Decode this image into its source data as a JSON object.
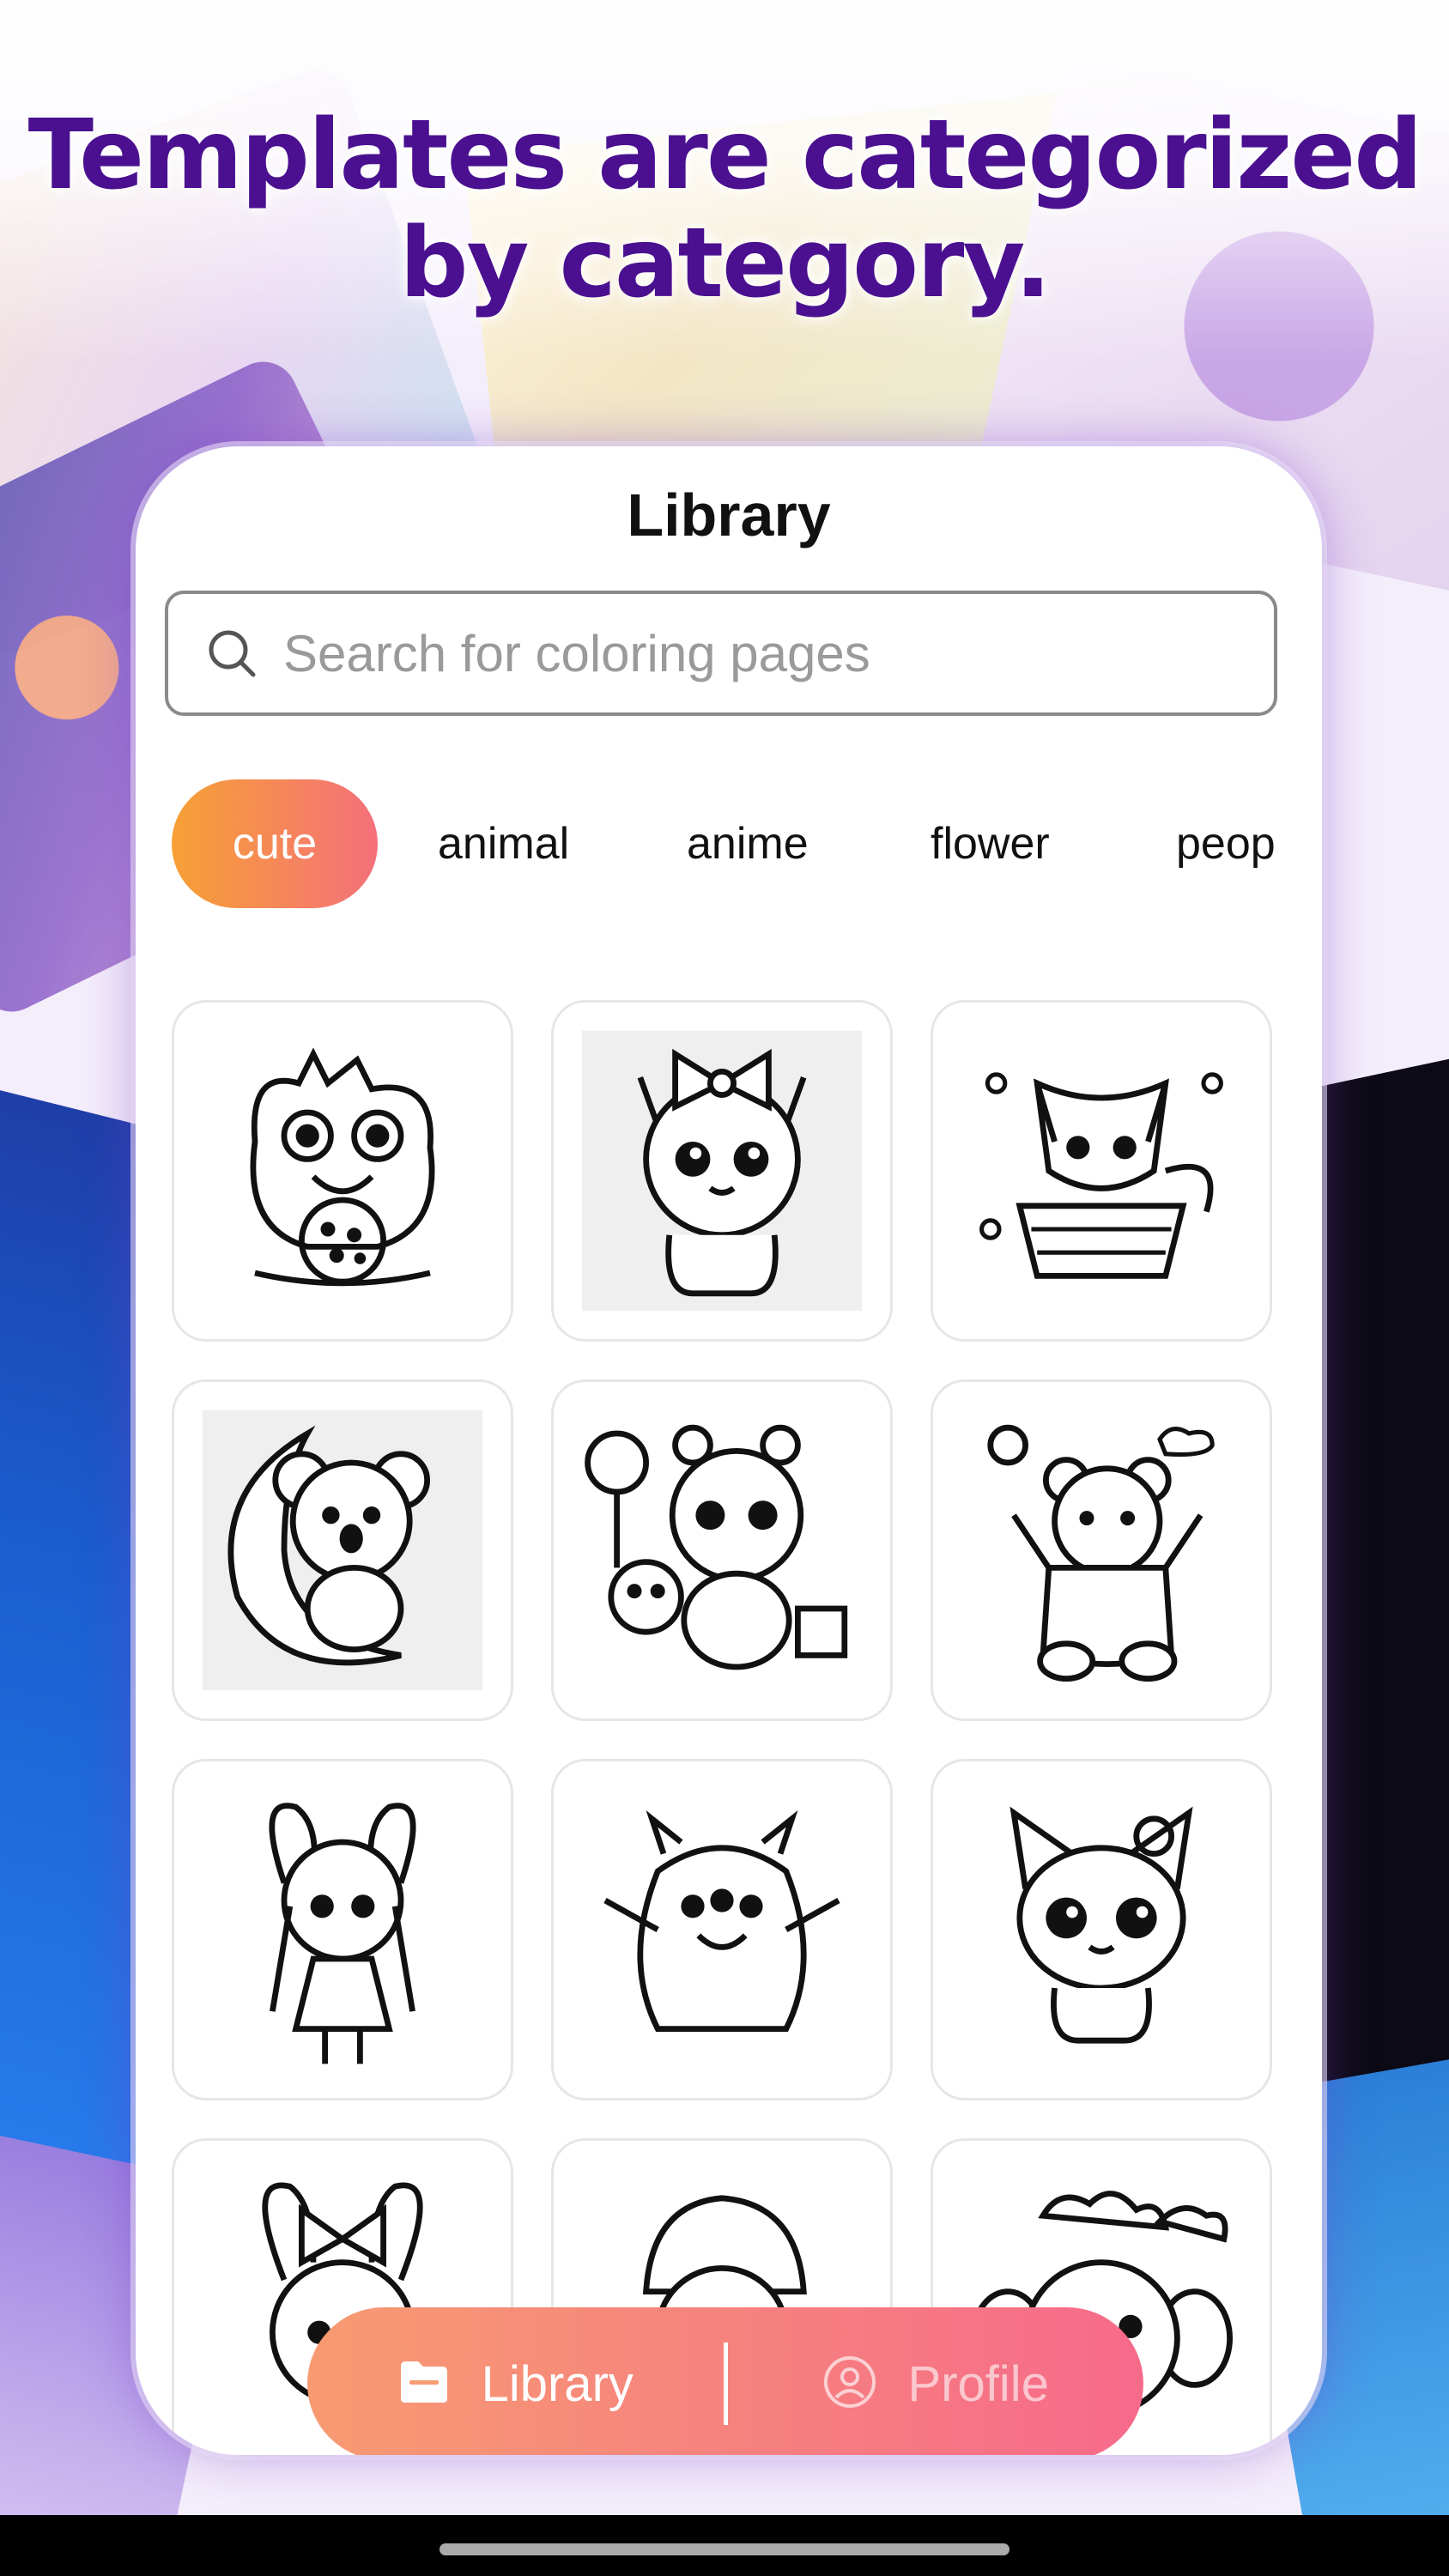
{
  "headline": {
    "line1": "Templates are categorized",
    "line2": "by category."
  },
  "screen": {
    "title": "Library",
    "search": {
      "placeholder": "Search for coloring pages",
      "icon": "search-icon"
    },
    "categories": [
      {
        "label": "cute",
        "active": true
      },
      {
        "label": "animal",
        "active": false
      },
      {
        "label": "anime",
        "active": false
      },
      {
        "label": "flower",
        "active": false
      },
      {
        "label": "peop",
        "active": false
      }
    ],
    "templates": [
      {
        "subject": "cute monster with cookie"
      },
      {
        "subject": "kitten with bow"
      },
      {
        "subject": "fox in basket"
      },
      {
        "subject": "koala on moon"
      },
      {
        "subject": "panda bears with candy"
      },
      {
        "subject": "teddy bear waving"
      },
      {
        "subject": "bunny hood girl"
      },
      {
        "subject": "fluffy monster"
      },
      {
        "subject": "kitten with flower"
      },
      {
        "subject": "bunny with bow"
      },
      {
        "subject": "anime girl with hat"
      },
      {
        "subject": "baby elephant"
      }
    ],
    "nav": {
      "library": {
        "label": "Library",
        "icon": "folder-icon",
        "active": true
      },
      "profile": {
        "label": "Profile",
        "icon": "user-icon",
        "active": false
      }
    }
  },
  "colors": {
    "headline": "#4a1090",
    "chip_active_gradient": [
      "#f7a035",
      "#f4707a"
    ],
    "bottom_bar_gradient": [
      "#f79b72",
      "#f66a8a"
    ]
  }
}
